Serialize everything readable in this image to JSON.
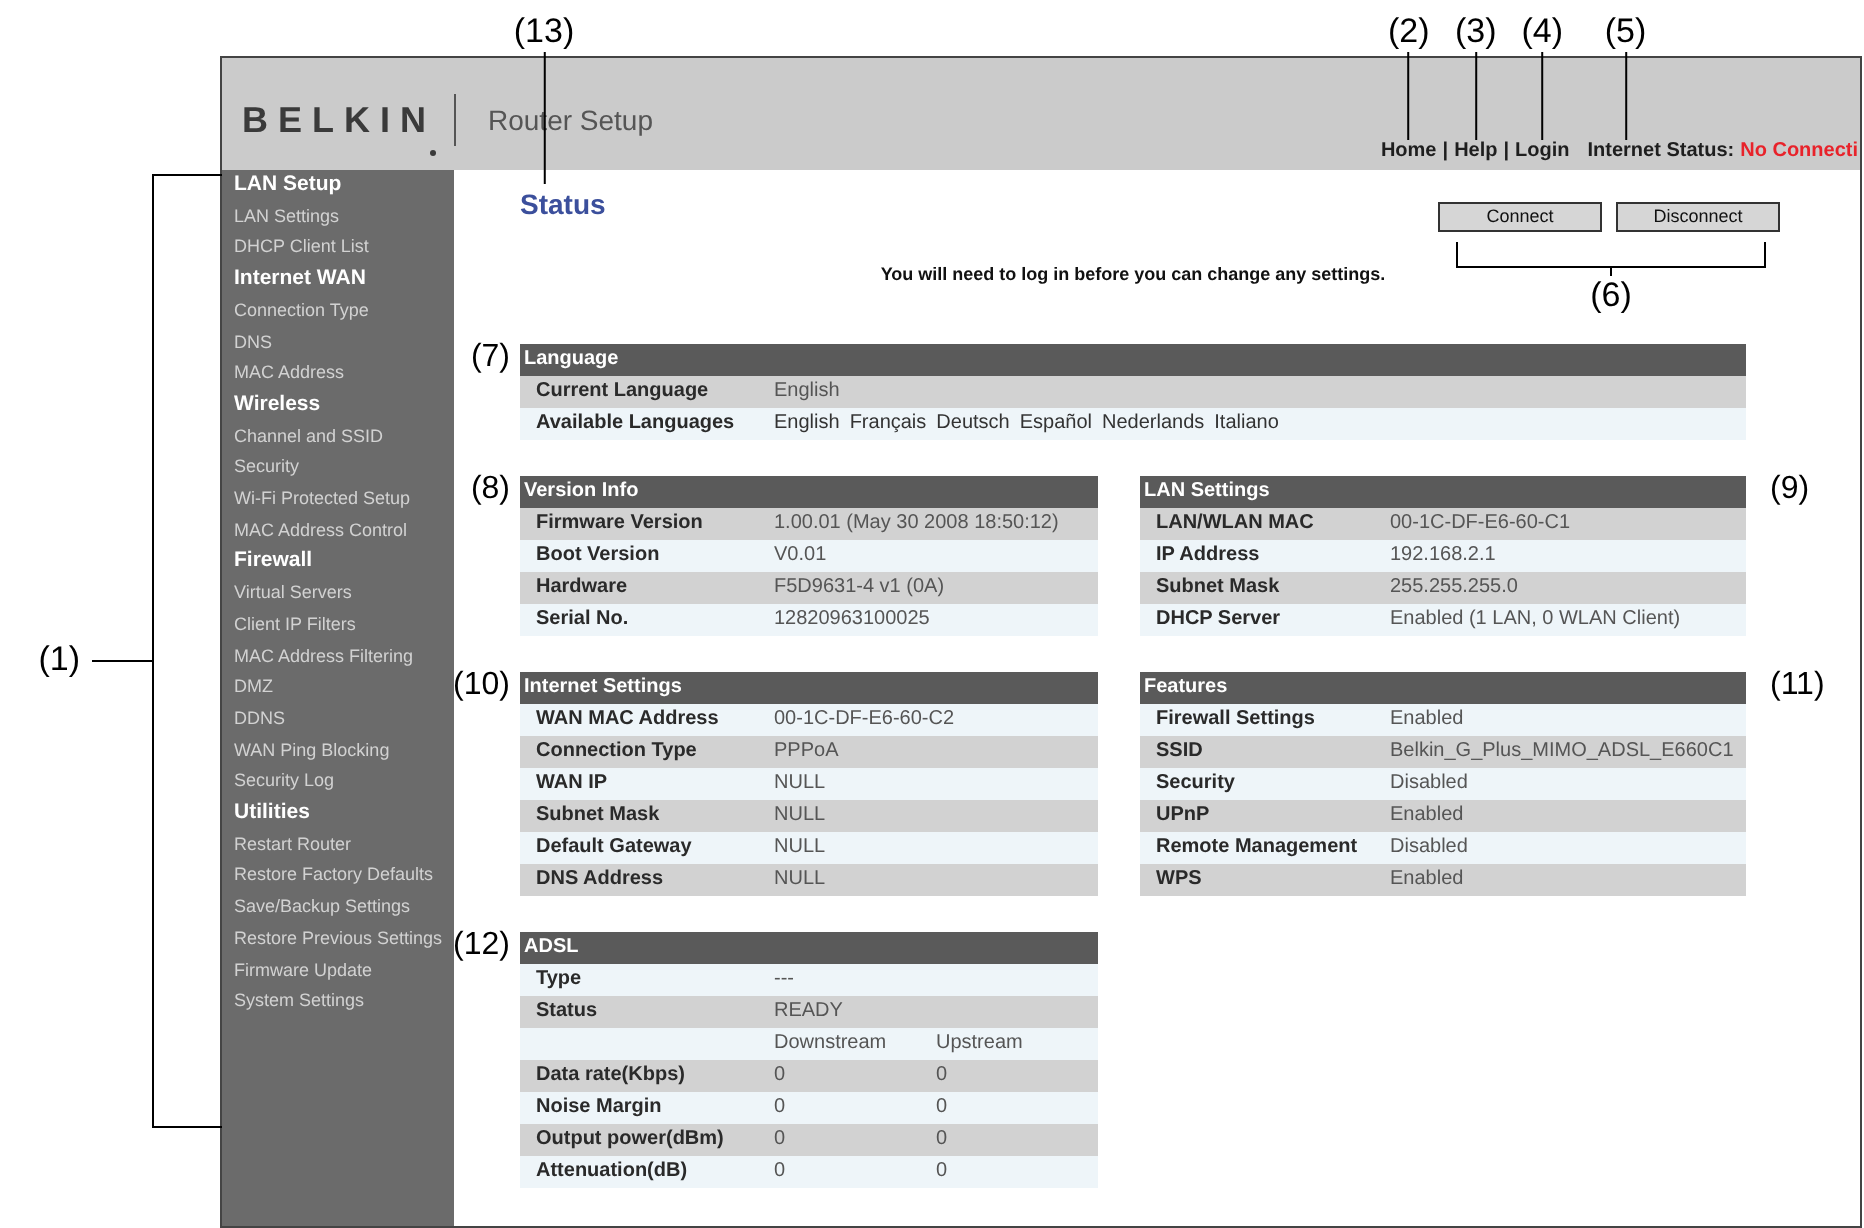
{
  "header": {
    "logo": "BELKIN",
    "title": "Router Setup",
    "link_separator": "|",
    "links": [
      {
        "label": "Home",
        "callout": "(2)"
      },
      {
        "label": "Help",
        "callout": "(3)"
      },
      {
        "label": "Login",
        "callout": "(4)"
      }
    ],
    "internet_status": {
      "label": "Internet Status:",
      "value": "No Connecti",
      "callout": "(5)"
    }
  },
  "sidebar": {
    "callout": "(1)",
    "sections": [
      {
        "heading": "LAN Setup",
        "items": [
          "LAN Settings",
          "DHCP Client List"
        ]
      },
      {
        "heading": "Internet WAN",
        "items": [
          "Connection Type",
          "DNS",
          "MAC Address"
        ]
      },
      {
        "heading": "Wireless",
        "items": [
          "Channel and SSID",
          "Security",
          "Wi-Fi Protected Setup",
          "MAC Address Control"
        ]
      },
      {
        "heading": "Firewall",
        "items": [
          "Virtual Servers",
          "Client IP Filters",
          "MAC Address Filtering",
          "DMZ",
          "DDNS",
          "WAN Ping Blocking",
          "Security Log"
        ]
      },
      {
        "heading": "Utilities",
        "items": [
          "Restart Router",
          "Restore Factory Defaults",
          "Save/Backup Settings",
          "Restore Previous Settings",
          "Firmware Update",
          "System Settings"
        ]
      }
    ]
  },
  "page": {
    "title": "Status",
    "title_callout": "(13)",
    "buttons": [
      "Connect",
      "Disconnect"
    ],
    "buttons_callout": "(6)",
    "notice": "You will need to log in before you can change any settings."
  },
  "tables": [
    {
      "title": "Language",
      "callout": "(7)",
      "rows": [
        {
          "label": "Current Language",
          "value": "English",
          "shaded": true
        },
        {
          "label": "Available Languages",
          "options": [
            "English",
            "Français",
            "Deutsch",
            "Español",
            "Nederlands",
            "Italiano"
          ],
          "shaded": false
        }
      ]
    },
    {
      "title": "Version Info",
      "callout": "(8)",
      "rows": [
        {
          "label": "Firmware Version",
          "value": "1.00.01 (May 30 2008 18:50:12)",
          "shaded": true
        },
        {
          "label": "Boot Version",
          "value": "V0.01",
          "shaded": false
        },
        {
          "label": "Hardware",
          "value": "F5D9631-4 v1 (0A)",
          "shaded": true
        },
        {
          "label": "Serial No.",
          "value": "12820963100025",
          "shaded": false
        }
      ]
    },
    {
      "title": "LAN Settings",
      "callout": "(9)",
      "rows": [
        {
          "label": "LAN/WLAN MAC",
          "value": "00-1C-DF-E6-60-C1",
          "shaded": true
        },
        {
          "label": "IP Address",
          "value": "192.168.2.1",
          "shaded": false
        },
        {
          "label": "Subnet Mask",
          "value": "255.255.255.0",
          "shaded": true
        },
        {
          "label": "DHCP Server",
          "value": "Enabled (1 LAN, 0 WLAN Client)",
          "shaded": false
        }
      ]
    },
    {
      "title": "Internet Settings",
      "callout": "(10)",
      "rows": [
        {
          "label": "WAN MAC Address",
          "value": "00-1C-DF-E6-60-C2",
          "shaded": false
        },
        {
          "label": "Connection Type",
          "value": "PPPoA",
          "shaded": true
        },
        {
          "label": "WAN IP",
          "value": "NULL",
          "shaded": false
        },
        {
          "label": "Subnet Mask",
          "value": "NULL",
          "shaded": true
        },
        {
          "label": "Default Gateway",
          "value": "NULL",
          "shaded": false
        },
        {
          "label": "DNS Address",
          "value": "NULL",
          "shaded": true
        }
      ]
    },
    {
      "title": "Features",
      "callout": "(11)",
      "rows": [
        {
          "label": "Firewall Settings",
          "value": "Enabled",
          "shaded": false
        },
        {
          "label": "SSID",
          "value": "Belkin_G_Plus_MIMO_ADSL_E660C1",
          "shaded": true
        },
        {
          "label": "Security",
          "value": "Disabled",
          "shaded": false
        },
        {
          "label": "UPnP",
          "value": "Enabled",
          "shaded": true
        },
        {
          "label": "Remote Management",
          "value": "Disabled",
          "shaded": false
        },
        {
          "label": "WPS",
          "value": "Enabled",
          "shaded": true
        }
      ]
    },
    {
      "title": "ADSL",
      "callout": "(12)",
      "rows": [
        {
          "label": "Type",
          "value": "---",
          "shaded": false
        },
        {
          "label": "Status",
          "value": "READY",
          "shaded": true
        },
        {
          "values": [
            "Downstream",
            "Upstream"
          ],
          "shaded": false
        },
        {
          "label": "Data rate(Kbps)",
          "values": [
            "0",
            "0"
          ],
          "shaded": true
        },
        {
          "label": "Noise Margin",
          "values": [
            "0",
            "0"
          ],
          "shaded": false
        },
        {
          "label": "Output power(dBm)",
          "values": [
            "0",
            "0"
          ],
          "shaded": true
        },
        {
          "label": "Attenuation(dB)",
          "values": [
            "0",
            "0"
          ],
          "shaded": false
        }
      ]
    }
  ]
}
